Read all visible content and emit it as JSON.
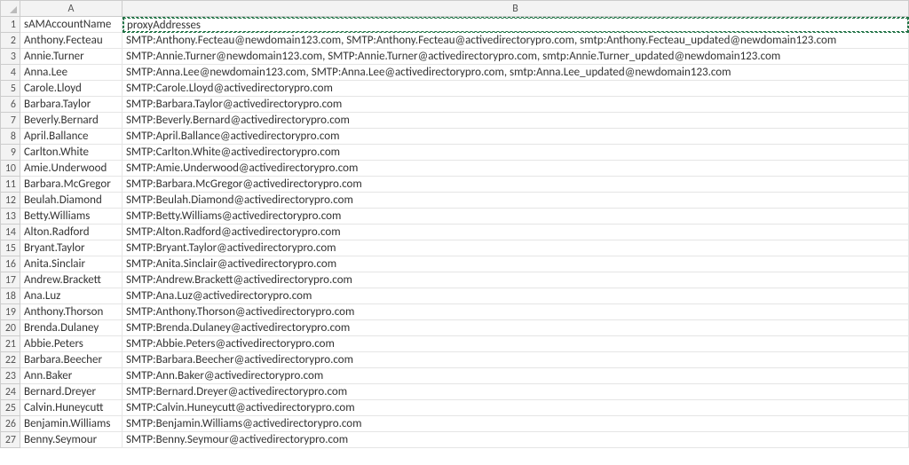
{
  "columns": {
    "A": "A",
    "B": "B"
  },
  "headers": {
    "A": "sAMAccountName",
    "B": "proxyAddresses"
  },
  "rows": [
    {
      "A": "Anthony.Fecteau",
      "B": " SMTP:Anthony.Fecteau@newdomain123.com,  SMTP:Anthony.Fecteau@activedirectorypro.com, smtp:Anthony.Fecteau_updated@newdomain123.com"
    },
    {
      "A": "Annie.Turner",
      "B": " SMTP:Annie.Turner@newdomain123.com,  SMTP:Annie.Turner@activedirectorypro.com, smtp:Annie.Turner_updated@newdomain123.com"
    },
    {
      "A": "Anna.Lee",
      "B": " SMTP:Anna.Lee@newdomain123.com,  SMTP:Anna.Lee@activedirectorypro.com, smtp:Anna.Lee_updated@newdomain123.com"
    },
    {
      "A": "Carole.Lloyd",
      "B": "SMTP:Carole.Lloyd@activedirectorypro.com"
    },
    {
      "A": "Barbara.Taylor",
      "B": "SMTP:Barbara.Taylor@activedirectorypro.com"
    },
    {
      "A": "Beverly.Bernard",
      "B": "SMTP:Beverly.Bernard@activedirectorypro.com"
    },
    {
      "A": "April.Ballance",
      "B": "SMTP:April.Ballance@activedirectorypro.com"
    },
    {
      "A": "Carlton.White",
      "B": "SMTP:Carlton.White@activedirectorypro.com"
    },
    {
      "A": "Amie.Underwood",
      "B": "SMTP:Amie.Underwood@activedirectorypro.com"
    },
    {
      "A": "Barbara.McGregor",
      "B": "SMTP:Barbara.McGregor@activedirectorypro.com"
    },
    {
      "A": "Beulah.Diamond",
      "B": "SMTP:Beulah.Diamond@activedirectorypro.com"
    },
    {
      "A": "Betty.Williams",
      "B": "SMTP:Betty.Williams@activedirectorypro.com"
    },
    {
      "A": "Alton.Radford",
      "B": "SMTP:Alton.Radford@activedirectorypro.com"
    },
    {
      "A": "Bryant.Taylor",
      "B": "SMTP:Bryant.Taylor@activedirectorypro.com"
    },
    {
      "A": "Anita.Sinclair",
      "B": "SMTP:Anita.Sinclair@activedirectorypro.com"
    },
    {
      "A": "Andrew.Brackett",
      "B": "SMTP:Andrew.Brackett@activedirectorypro.com"
    },
    {
      "A": "Ana.Luz",
      "B": "SMTP:Ana.Luz@activedirectorypro.com"
    },
    {
      "A": "Anthony.Thorson",
      "B": "SMTP:Anthony.Thorson@activedirectorypro.com"
    },
    {
      "A": "Brenda.Dulaney",
      "B": "SMTP:Brenda.Dulaney@activedirectorypro.com"
    },
    {
      "A": "Abbie.Peters",
      "B": "SMTP:Abbie.Peters@activedirectorypro.com"
    },
    {
      "A": "Barbara.Beecher",
      "B": "SMTP:Barbara.Beecher@activedirectorypro.com"
    },
    {
      "A": "Ann.Baker",
      "B": "SMTP:Ann.Baker@activedirectorypro.com"
    },
    {
      "A": "Bernard.Dreyer",
      "B": "SMTP:Bernard.Dreyer@activedirectorypro.com"
    },
    {
      "A": "Calvin.Huneycutt",
      "B": "SMTP:Calvin.Huneycutt@activedirectorypro.com"
    },
    {
      "A": "Benjamin.Williams",
      "B": "SMTP:Benjamin.Williams@activedirectorypro.com"
    },
    {
      "A": "Benny.Seymour",
      "B": "SMTP:Benny.Seymour@activedirectorypro.com"
    }
  ],
  "selected_cell": "B1"
}
